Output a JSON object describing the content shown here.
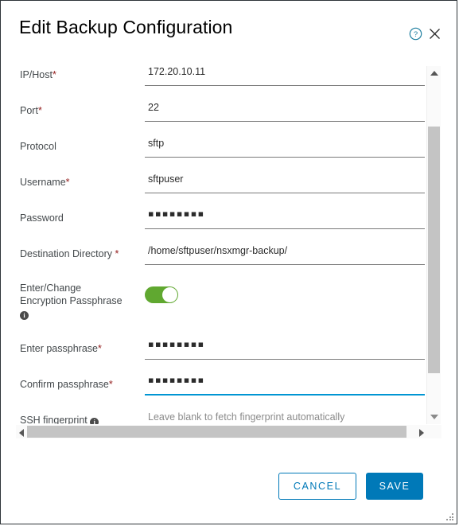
{
  "dialog": {
    "title": "Edit Backup Configuration",
    "help_icon": "help-circle-icon",
    "close_icon": "close-icon"
  },
  "form": {
    "fields": [
      {
        "label": "IP/Host",
        "required": true,
        "value": "172.20.10.11",
        "type": "text",
        "focused": false
      },
      {
        "label": "Port",
        "required": true,
        "value": "22",
        "type": "text",
        "focused": false
      },
      {
        "label": "Protocol",
        "required": false,
        "value": "sftp",
        "type": "text",
        "focused": false
      },
      {
        "label": "Username",
        "required": true,
        "value": "sftpuser",
        "type": "text",
        "focused": false
      },
      {
        "label": "Password",
        "required": false,
        "value": "▪▪▪▪▪▪▪▪",
        "type": "password",
        "focused": false
      },
      {
        "label": "Destination Directory",
        "required": true,
        "value": "/home/sftpuser/nsxmgr-backup/",
        "type": "text",
        "focused": false
      },
      {
        "label": "Enter passphrase",
        "required": true,
        "value": "▪▪▪▪▪▪▪▪",
        "type": "password",
        "focused": false
      },
      {
        "label": "Confirm passphrase",
        "required": true,
        "value": "▪▪▪▪▪▪▪▪",
        "type": "password",
        "focused": true
      }
    ],
    "passphrase_toggle": {
      "label_line1": "Enter/Change",
      "label_line2": "Encryption Passphrase",
      "state": "on",
      "color": "#60a830",
      "info_icon": "info-icon"
    },
    "ssh_fingerprint": {
      "label": "SSH fingerprint",
      "info_icon": "info-icon",
      "placeholder": "Leave blank to fetch fingerprint automatically",
      "value": ""
    }
  },
  "footer": {
    "cancel_label": "CANCEL",
    "save_label": "SAVE"
  },
  "colors": {
    "accent_blue": "#0079b8",
    "focus_underline": "#0095d3",
    "toggle_green": "#60a830",
    "required_red": "#952020"
  }
}
